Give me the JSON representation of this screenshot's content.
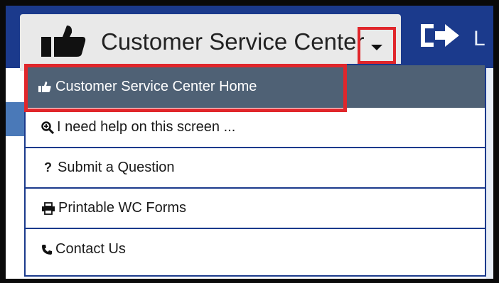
{
  "header": {
    "title": "Customer Service Center",
    "logout_label": "L",
    "icons": {
      "title_icon": "thumbs-up-icon",
      "dropdown_icon": "caret-down-icon",
      "logout_icon": "sign-out-icon"
    }
  },
  "dropdown": {
    "items": [
      {
        "label": "Customer Service Center Home",
        "icon": "thumbs-up-icon",
        "active": true
      },
      {
        "label": "I need help on this screen ...",
        "icon": "search-plus-icon"
      },
      {
        "label": "Submit a Question",
        "icon": "question-icon"
      },
      {
        "label": "Printable WC Forms",
        "icon": "print-icon"
      },
      {
        "label": "Contact Us",
        "icon": "phone-icon"
      }
    ]
  },
  "colors": {
    "header_bg": "#1b3a8c",
    "highlight_red": "#e0262b",
    "active_item_bg": "#4f6175"
  }
}
